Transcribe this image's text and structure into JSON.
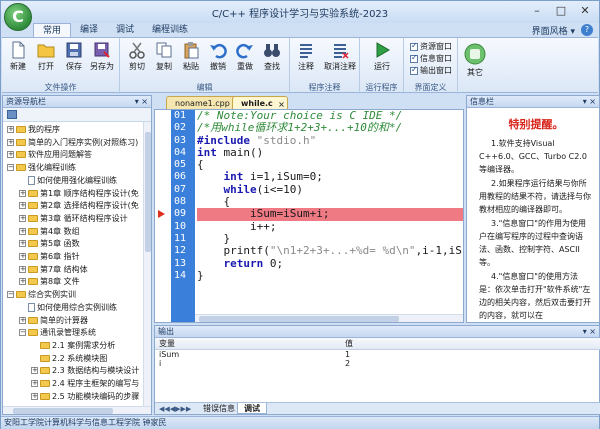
{
  "app": {
    "title": "C/C++ 程序设计学习与实验系统-2023",
    "logo_letter": "C"
  },
  "ribbon_tabs": [
    "常用",
    "编译",
    "调试",
    "编程训练"
  ],
  "ui_style_label": "界面风格 ▾",
  "help_glyph": "?",
  "ribbon": {
    "file_ops": {
      "label": "文件操作",
      "buttons": [
        "新建",
        "打开",
        "保存",
        "另存为"
      ]
    },
    "edit": {
      "label": "编辑",
      "buttons": [
        "剪切",
        "复制",
        "粘贴",
        "撤销",
        "重做",
        "查找"
      ]
    },
    "comment": {
      "label": "程序注释",
      "buttons": [
        "注释",
        "取消注释"
      ]
    },
    "run": {
      "label": "运行程序",
      "buttons": [
        "运行"
      ]
    },
    "view": {
      "label": "界面定义",
      "checks": [
        "资源窗口",
        "信息窗口",
        "输出窗口"
      ]
    },
    "other": {
      "label": "其它"
    }
  },
  "nav": {
    "title": "资源导航栏",
    "items": [
      {
        "text": "我的程序",
        "level": 0,
        "kind": "folder",
        "expander": "+"
      },
      {
        "text": "简单的入门程序实例(对照练习)",
        "level": 0,
        "kind": "folder",
        "expander": "+"
      },
      {
        "text": "软件应用问题解答",
        "level": 0,
        "kind": "folder",
        "expander": "+"
      },
      {
        "text": "强化编程训练",
        "level": 0,
        "kind": "folder",
        "expander": "−"
      },
      {
        "text": "如何使用强化编程训练",
        "level": 1,
        "kind": "doc",
        "expander": ""
      },
      {
        "text": "第1章 顺序结构程序设计(免",
        "level": 1,
        "kind": "folder",
        "expander": "+"
      },
      {
        "text": "第2章 选择结构程序设计(免",
        "level": 1,
        "kind": "folder",
        "expander": "+"
      },
      {
        "text": "第3章 循环结构程序设计",
        "level": 1,
        "kind": "folder",
        "expander": "+"
      },
      {
        "text": "第4章 数组",
        "level": 1,
        "kind": "folder",
        "expander": "+"
      },
      {
        "text": "第5章 函数",
        "level": 1,
        "kind": "folder",
        "expander": "+"
      },
      {
        "text": "第6章 指针",
        "level": 1,
        "kind": "folder",
        "expander": "+"
      },
      {
        "text": "第7章 结构体",
        "level": 1,
        "kind": "folder",
        "expander": "+"
      },
      {
        "text": "第8章 文件",
        "level": 1,
        "kind": "folder",
        "expander": "+"
      },
      {
        "text": "综合实例实训",
        "level": 0,
        "kind": "folder",
        "expander": "−"
      },
      {
        "text": "如何使用综合实例训练",
        "level": 1,
        "kind": "doc",
        "expander": ""
      },
      {
        "text": "简单的计算器",
        "level": 1,
        "kind": "folder",
        "expander": "+"
      },
      {
        "text": "通讯录管理系统",
        "level": 1,
        "kind": "folder",
        "expander": "−"
      },
      {
        "text": "2.1 案例需求分析",
        "level": 2,
        "kind": "folder",
        "expander": ""
      },
      {
        "text": "2.2 系统模块图",
        "level": 2,
        "kind": "folder",
        "expander": ""
      },
      {
        "text": "2.3 数据结构与模块设计",
        "level": 2,
        "kind": "folder",
        "expander": "+"
      },
      {
        "text": "2.4 程序主框架的编写与",
        "level": 2,
        "kind": "folder",
        "expander": "+"
      },
      {
        "text": "2.5 功能模块编码的步骤",
        "level": 2,
        "kind": "folder",
        "expander": "+"
      }
    ]
  },
  "editor": {
    "tabs": [
      "noname1.cpp",
      "while.c"
    ],
    "close_glyph": "×",
    "line_numbers": [
      "01",
      "02",
      "03",
      "04",
      "05",
      "06",
      "07",
      "08",
      "09",
      "10",
      "11",
      "12",
      "13",
      "14"
    ],
    "highlight_line": 9,
    "lines": [
      [
        {
          "t": "/* Note:Your choice is C IDE */",
          "c": "cm"
        }
      ],
      [
        {
          "t": "/*用while循环求1+2+3+...+10的和*/",
          "c": "cm"
        }
      ],
      [
        {
          "t": "#include ",
          "c": "kw"
        },
        {
          "t": "\"stdio.h\"",
          "c": "str"
        }
      ],
      [
        {
          "t": "int",
          "c": "kw"
        },
        {
          "t": " main()",
          "c": ""
        }
      ],
      [
        {
          "t": "{",
          "c": ""
        }
      ],
      [
        {
          "t": "    ",
          "c": ""
        },
        {
          "t": "int",
          "c": "kw"
        },
        {
          "t": " i=1,iSum=0;",
          "c": ""
        }
      ],
      [
        {
          "t": "    ",
          "c": ""
        },
        {
          "t": "while",
          "c": "kw"
        },
        {
          "t": "(i<=10)",
          "c": ""
        }
      ],
      [
        {
          "t": "    {",
          "c": ""
        }
      ],
      [
        {
          "t": "        iSum=iSum+i;",
          "c": ""
        }
      ],
      [
        {
          "t": "        i++;",
          "c": ""
        }
      ],
      [
        {
          "t": "    }",
          "c": ""
        }
      ],
      [
        {
          "t": "    printf(",
          "c": ""
        },
        {
          "t": "\"\\n1+2+3+...+%d= %d\\n\"",
          "c": "str"
        },
        {
          "t": ",i-1,iS",
          "c": ""
        }
      ],
      [
        {
          "t": "    ",
          "c": ""
        },
        {
          "t": "return",
          "c": "kw"
        },
        {
          "t": " 0;",
          "c": ""
        }
      ],
      [
        {
          "t": "}",
          "c": ""
        }
      ]
    ]
  },
  "info": {
    "title": "信息栏",
    "heading": "特别提醒。",
    "paragraphs": [
      "1.软件支持Visual C++6.0、GCC、Turbo C2.0等编译器。",
      "2.如果程序运行结果与你所用教程的结果不符，请选择与你教材相应的编译器即可。",
      "3.\"信息窗口\"的作用为使用户在编写程序的过程中查询语法、函数、控制字符、ASCII等。",
      "4.\"信息窗口\"的使用方法是：依次单击打开\"软件系统\"左边的相关内容，然后双击要打开的内容，就可以在"
    ]
  },
  "output": {
    "title": "输出",
    "columns": [
      "变量",
      "值"
    ],
    "rows": [
      [
        "iSum",
        "1"
      ],
      [
        "i",
        "2"
      ]
    ],
    "tabs": [
      "错误信息",
      "调试"
    ]
  },
  "status": "安阳工学院计算机科学与信息工程学院 钟家民"
}
